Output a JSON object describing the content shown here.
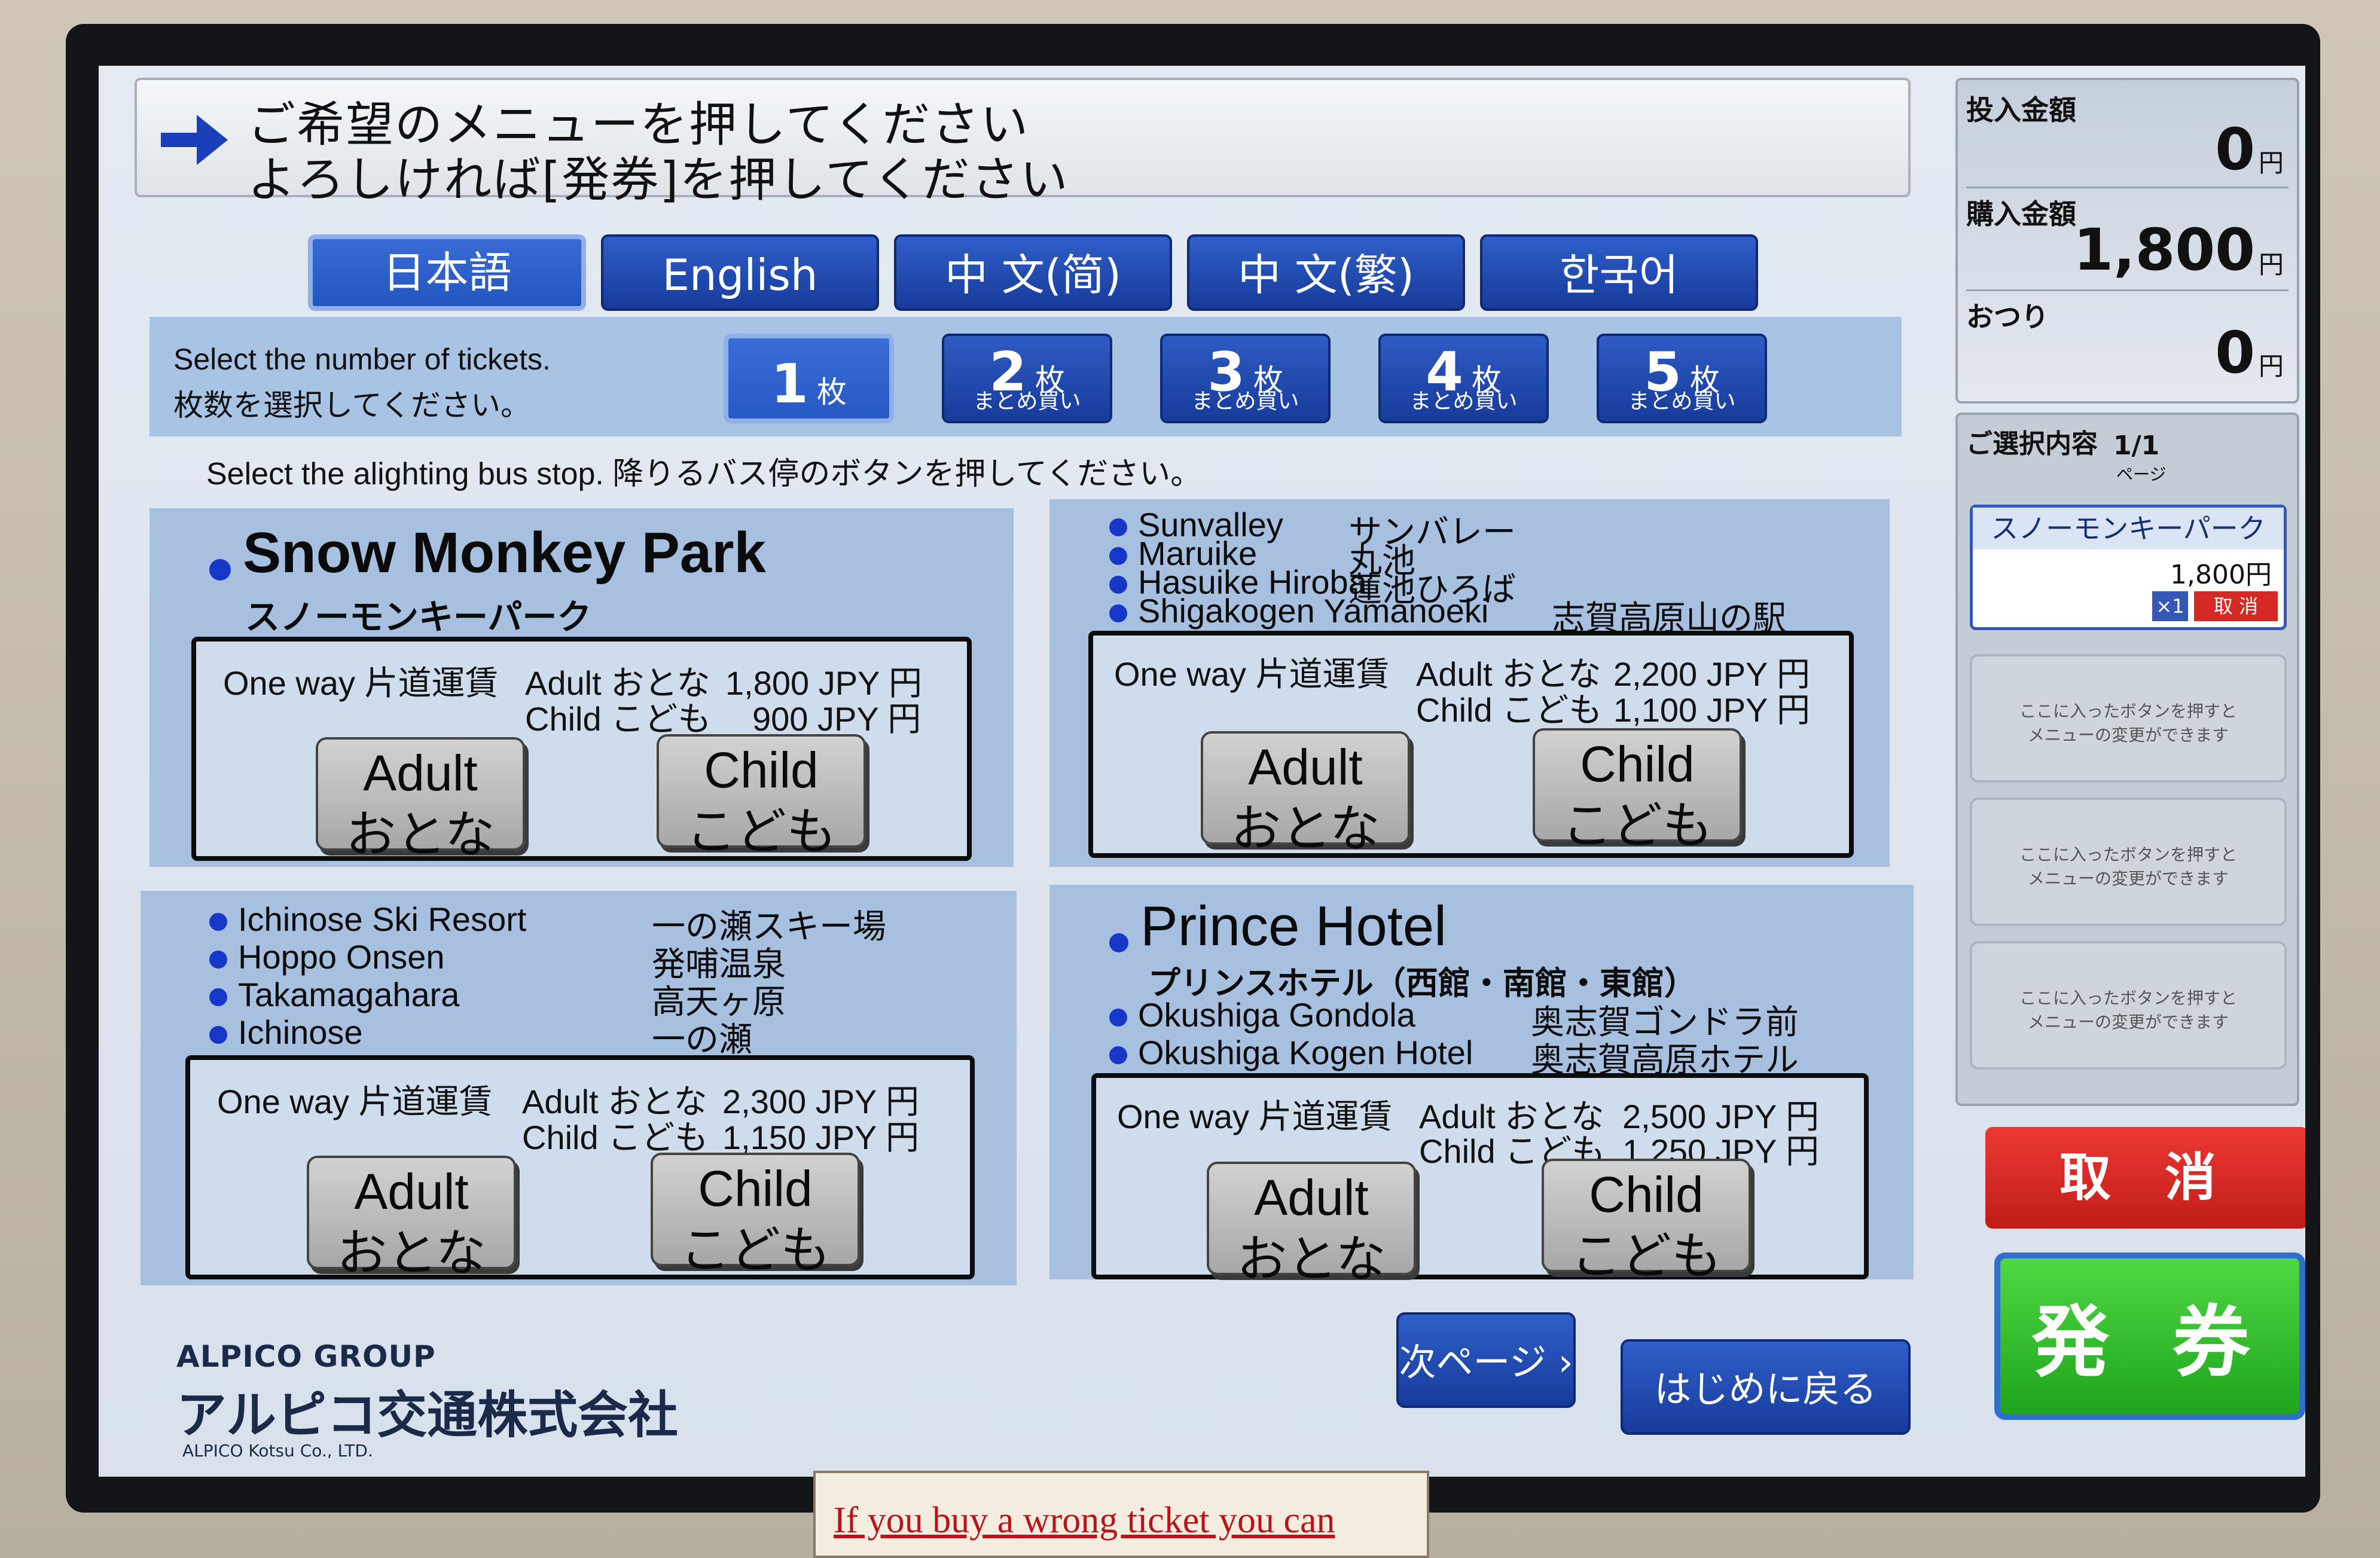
{
  "instruction": {
    "line1": "ご希望のメニューを押してください",
    "line2": "よろしければ[発券]を押してください"
  },
  "languages": [
    {
      "label": "日本語",
      "active": true
    },
    {
      "label": "English",
      "active": false
    },
    {
      "label": "中 文(简)",
      "active": false
    },
    {
      "label": "中 文(繁)",
      "active": false
    },
    {
      "label": "한국어",
      "active": false
    }
  ],
  "ticket_count": {
    "prompt_en": "Select the number of tickets.",
    "prompt_ja": "枚数を選択してください。",
    "unit": "枚",
    "bulk_label": "まとめ買い",
    "options": [
      "1",
      "2",
      "3",
      "4",
      "5"
    ]
  },
  "alighting_prompt": "Select the alighting bus stop.   降りるバス停のボタンを押してください。",
  "fare_labels": {
    "one_way": "One way 片道運賃",
    "adult": "Adult",
    "adult_ja": "おとな",
    "child": "Child",
    "child_ja": "こども",
    "currency": "JPY 円"
  },
  "panels": {
    "snow_monkey": {
      "title": "Snow Monkey Park",
      "title_ja": "スノーモンキーパーク",
      "adult_fare": "1,800",
      "child_fare": "900"
    },
    "sunvalley": {
      "stops": [
        {
          "en": "Sunvalley",
          "ja": "サンバレー"
        },
        {
          "en": "Maruike",
          "ja": "丸池"
        },
        {
          "en": "Hasuike Hiroba",
          "ja": "蓮池ひろば"
        },
        {
          "en": "Shigakogen Yamanoeki",
          "ja": "志賀高原山の駅"
        }
      ],
      "adult_fare": "2,200",
      "child_fare": "1,100"
    },
    "ichinose": {
      "stops": [
        {
          "en": "Ichinose Ski Resort",
          "ja": "一の瀬スキー場"
        },
        {
          "en": "Hoppo Onsen",
          "ja": "発哺温泉"
        },
        {
          "en": "Takamagahara",
          "ja": "高天ヶ原"
        },
        {
          "en": "Ichinose",
          "ja": "一の瀬"
        }
      ],
      "adult_fare": "2,300",
      "child_fare": "1,150"
    },
    "prince": {
      "title": "Prince Hotel",
      "title_ja": "プリンスホテル（西館・南館・東館）",
      "stops": [
        {
          "en": "Okushiga Gondola",
          "ja": "奥志賀ゴンドラ前"
        },
        {
          "en": "Okushiga Kogen Hotel",
          "ja": "奥志賀高原ホテル"
        }
      ],
      "adult_fare": "2,500",
      "child_fare": "1,250"
    }
  },
  "footer": {
    "logo_group": "ALPICO GROUP",
    "logo_ja": "アルピコ交通株式会社",
    "logo_en": "ALPICO Kotsu Co., LTD.",
    "next_page": "次ページ ›",
    "back_to_start": "はじめに戻る"
  },
  "money": {
    "inserted_label": "投入金額",
    "inserted_value": "0",
    "purchase_label": "購入金額",
    "purchase_value": "1,800",
    "change_label": "おつり",
    "change_value": "0",
    "yen": "円"
  },
  "selection": {
    "header": "ご選択内容",
    "page": "1/1",
    "page_label": "ページ",
    "item_name": "スノーモンキーパーク",
    "item_price": "1,800円",
    "item_qty": "×1",
    "item_cancel": "取 消",
    "empty_slot_line1": "ここに入ったボタンを押すと",
    "empty_slot_line2": "メニューの変更ができます"
  },
  "cancel_button": "取 消",
  "issue_button": "発 券",
  "notice": "If you buy a wrong ticket you can",
  "colors": {
    "accent_blue": "#173b9b",
    "cancel_red": "#d42a25",
    "issue_green": "#2fb52a",
    "panel_blue": "#a7c0e0"
  }
}
